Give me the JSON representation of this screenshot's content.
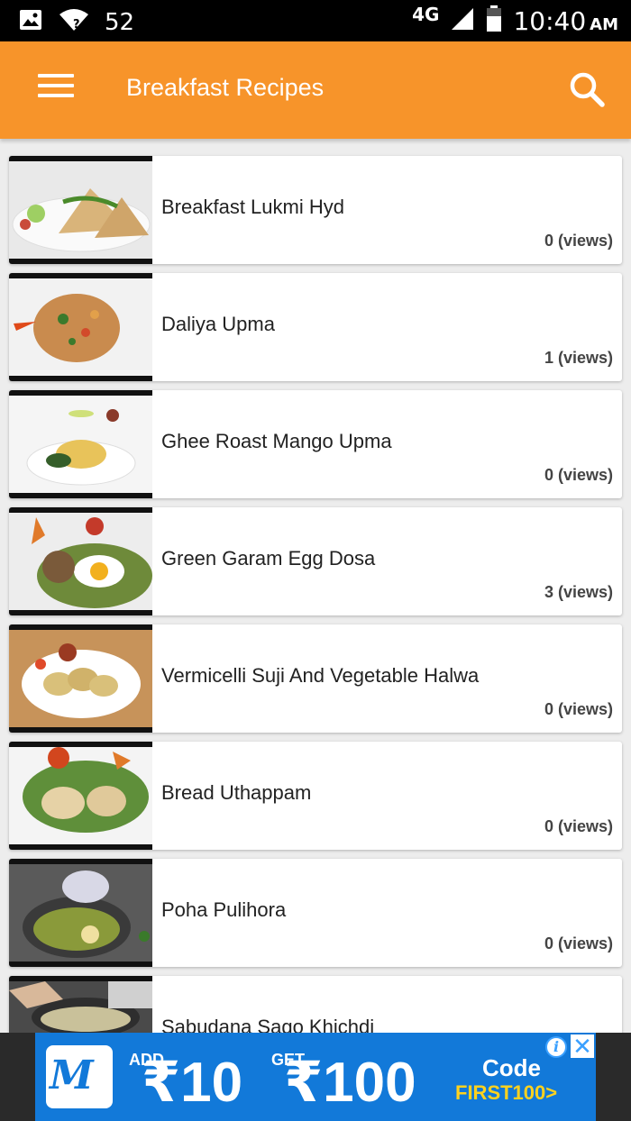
{
  "status_bar": {
    "signal_number": "52",
    "network_type": "4G",
    "time": "10:40",
    "ampm": "AM"
  },
  "app_bar": {
    "title": "Breakfast Recipes",
    "menu_icon": "hamburger-menu-icon",
    "search_icon": "search-icon"
  },
  "recipes": [
    {
      "title": "Breakfast Lukmi Hyd",
      "views": "0 (views)"
    },
    {
      "title": "Daliya Upma",
      "views": "1 (views)"
    },
    {
      "title": "Ghee Roast Mango Upma",
      "views": "0 (views)"
    },
    {
      "title": "Green Garam Egg Dosa",
      "views": "3 (views)"
    },
    {
      "title": "Vermicelli Suji And Vegetable Halwa",
      "views": "0 (views)"
    },
    {
      "title": "Bread Uthappam",
      "views": "0 (views)"
    },
    {
      "title": "Poha Pulihora",
      "views": "0 (views)"
    },
    {
      "title": "Sabudana Sago Khichdi",
      "views": ""
    }
  ],
  "ad": {
    "logo_letter": "M",
    "add_label": "ADD",
    "add_amount": "₹10",
    "get_label": "GET",
    "get_amount": "₹100",
    "code_label": "Code",
    "promo_code": "FIRST100>",
    "info_icon": "info-icon",
    "close_icon": "close-icon"
  },
  "colors": {
    "app_bar": "#f7942a",
    "ad_background": "#1279d9",
    "promo_code": "#ffd21e"
  }
}
